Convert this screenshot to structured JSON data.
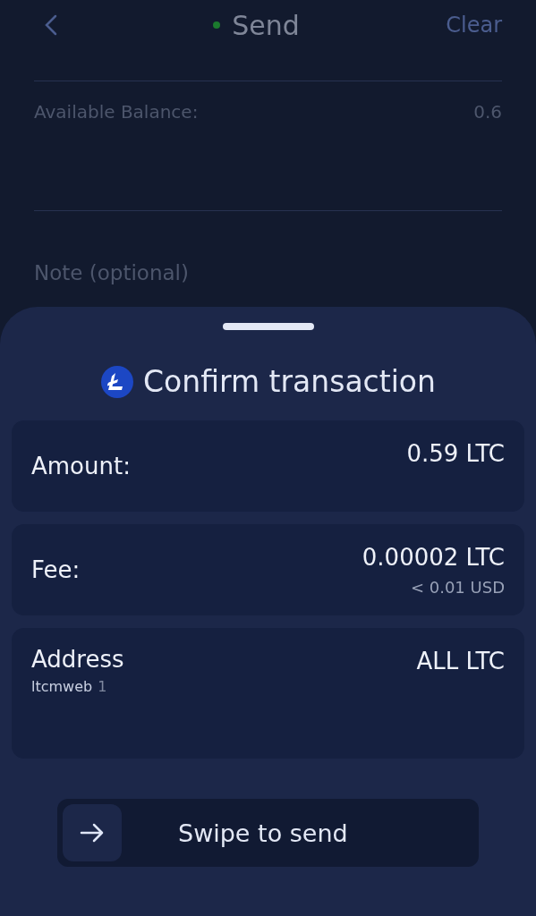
{
  "header": {
    "title": "Send",
    "action": "Clear"
  },
  "form": {
    "balance_label": "Available Balance:",
    "balance_value": "0.6",
    "note_placeholder": "Note (optional)"
  },
  "sheet": {
    "title": "Confirm transaction",
    "rows": [
      {
        "label": "Amount:",
        "value": "0.59 LTC"
      },
      {
        "label": "Fee:",
        "value": "0.00002 LTC",
        "subvalue": "< 0.01 USD"
      },
      {
        "label": "Address",
        "note": "ltcmweb",
        "note_count": "1",
        "value": "ALL LTC"
      }
    ],
    "swipe": {
      "label": "Swipe to send",
      "level": 0
    }
  }
}
